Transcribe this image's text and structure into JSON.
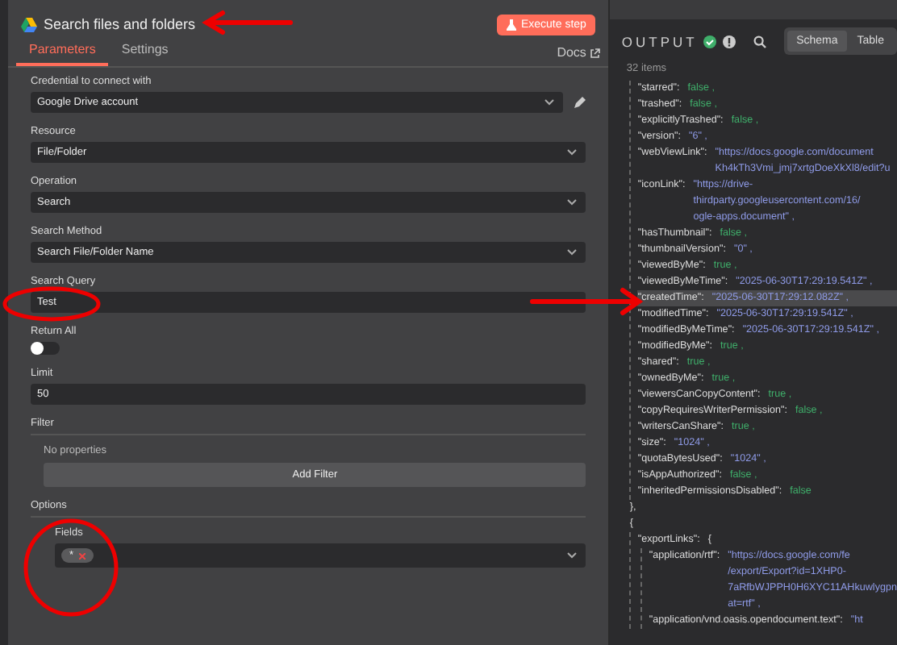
{
  "node": {
    "title": "Search files and folders",
    "execute_button": "Execute step",
    "docs_link": "Docs",
    "tabs": [
      {
        "label": "Parameters",
        "selected": true
      },
      {
        "label": "Settings",
        "selected": false
      }
    ],
    "parameters": [
      {
        "kind": "credential",
        "label": "Credential to connect with",
        "value": "Google Drive account"
      },
      {
        "kind": "select",
        "label": "Resource",
        "value": "File/Folder"
      },
      {
        "kind": "select",
        "label": "Operation",
        "value": "Search"
      },
      {
        "kind": "select",
        "label": "Search Method",
        "value": "Search File/Folder Name"
      },
      {
        "kind": "text",
        "label": "Search Query",
        "value": "Test"
      },
      {
        "kind": "toggle",
        "label": "Return All",
        "on": false
      },
      {
        "kind": "text",
        "label": "Limit",
        "value": "50"
      },
      {
        "kind": "collection",
        "label": "Filter",
        "empty_text": "No properties",
        "button": "Add Filter"
      },
      {
        "kind": "options",
        "label": "Options",
        "field_label": "Fields",
        "chips": [
          "*"
        ]
      }
    ]
  },
  "output": {
    "title": "OUTPUT",
    "views": [
      {
        "label": "Schema",
        "selected": true
      },
      {
        "label": "Table",
        "selected": false
      }
    ],
    "count": "32 items",
    "blocks": [
      {
        "entries": [
          {
            "key": "\"starred\":",
            "value": [
              "false"
            ],
            "kind": "bool",
            "suffix": ",",
            "highlighted": false
          },
          {
            "key": "\"trashed\":",
            "value": [
              "false"
            ],
            "kind": "bool",
            "suffix": ",",
            "highlighted": false
          },
          {
            "key": "\"explicitlyTrashed\":",
            "value": [
              "false"
            ],
            "kind": "bool",
            "suffix": ",",
            "highlighted": false
          },
          {
            "key": "\"version\":",
            "value": [
              "\"6\""
            ],
            "kind": "string",
            "suffix": ",",
            "highlighted": false
          },
          {
            "key": "\"webViewLink\":",
            "value": [
              "\"https://docs.google.com/document",
              "Kh4kTh3Vmi_jmj7xrtgDoeXkXl8/edit?u"
            ],
            "kind": "string",
            "highlighted": false
          },
          {
            "key": "\"iconLink\":",
            "value": [
              "\"https://drive-",
              "thirdparty.googleusercontent.com/16/",
              "ogle-apps.document\""
            ],
            "kind": "string",
            "suffix": ",",
            "highlighted": false
          },
          {
            "key": "\"hasThumbnail\":",
            "value": [
              "false"
            ],
            "kind": "bool",
            "suffix": ",",
            "highlighted": false
          },
          {
            "key": "\"thumbnailVersion\":",
            "value": [
              "\"0\""
            ],
            "kind": "string",
            "suffix": ",",
            "highlighted": false
          },
          {
            "key": "\"viewedByMe\":",
            "value": [
              "true"
            ],
            "kind": "bool",
            "suffix": ",",
            "highlighted": false
          },
          {
            "key": "\"viewedByMeTime\":",
            "value": [
              "\"2025-06-30T17:29:19.541Z\""
            ],
            "kind": "string",
            "suffix": ",",
            "highlighted": false
          },
          {
            "key": "\"createdTime\":",
            "value": [
              "\"2025-06-30T17:29:12.082Z\""
            ],
            "kind": "string",
            "suffix": ",",
            "highlighted": true
          },
          {
            "key": "\"modifiedTime\":",
            "value": [
              "\"2025-06-30T17:29:19.541Z\""
            ],
            "kind": "string",
            "suffix": ",",
            "highlighted": false
          },
          {
            "key": "\"modifiedByMeTime\":",
            "value": [
              "\"2025-06-30T17:29:19.541Z\""
            ],
            "kind": "string",
            "suffix": ",",
            "highlighted": false
          },
          {
            "key": "\"modifiedByMe\":",
            "value": [
              "true"
            ],
            "kind": "bool",
            "suffix": ",",
            "highlighted": false
          },
          {
            "key": "\"shared\":",
            "value": [
              "true"
            ],
            "kind": "bool",
            "suffix": ",",
            "highlighted": false
          },
          {
            "key": "\"ownedByMe\":",
            "value": [
              "true"
            ],
            "kind": "bool",
            "suffix": ",",
            "highlighted": false
          },
          {
            "key": "\"viewersCanCopyContent\":",
            "value": [
              "true"
            ],
            "kind": "bool",
            "suffix": ",",
            "highlighted": false
          },
          {
            "key": "\"copyRequiresWriterPermission\":",
            "value": [
              "false"
            ],
            "kind": "bool",
            "suffix": ",",
            "highlighted": false
          },
          {
            "key": "\"writersCanShare\":",
            "value": [
              "true"
            ],
            "kind": "bool",
            "suffix": ",",
            "highlighted": false
          },
          {
            "key": "\"size\":",
            "value": [
              "\"1024\""
            ],
            "kind": "string",
            "suffix": ",",
            "highlighted": false
          },
          {
            "key": "\"quotaBytesUsed\":",
            "value": [
              "\"1024\""
            ],
            "kind": "string",
            "suffix": ",",
            "highlighted": false
          },
          {
            "key": "\"isAppAuthorized\":",
            "value": [
              "false"
            ],
            "kind": "bool",
            "suffix": ",",
            "highlighted": false
          },
          {
            "key": "\"inheritedPermissionsDisabled\":",
            "value": [
              "false"
            ],
            "kind": "bool",
            "highlighted": false
          }
        ],
        "close": "},"
      },
      {
        "open": "{",
        "entries": [
          {
            "key": "\"exportLinks\":",
            "value": [
              "{"
            ],
            "kind": "bracket",
            "highlighted": false,
            "children": [
              {
                "key": "\"application/rtf\":",
                "value": [
                  "\"https://docs.google.com/fe",
                  "/export/Export?id=1XHP0-",
                  "7aRfbWJPPH0H6XYC11AHkuwlygpn",
                  "at=rtf\""
                ],
                "kind": "string",
                "suffix": ",",
                "highlighted": false
              },
              {
                "key": "\"application/vnd.oasis.opendocument.text\":",
                "value": [
                  "\"ht"
                ],
                "kind": "string",
                "highlighted": false
              }
            ]
          }
        ]
      }
    ]
  }
}
